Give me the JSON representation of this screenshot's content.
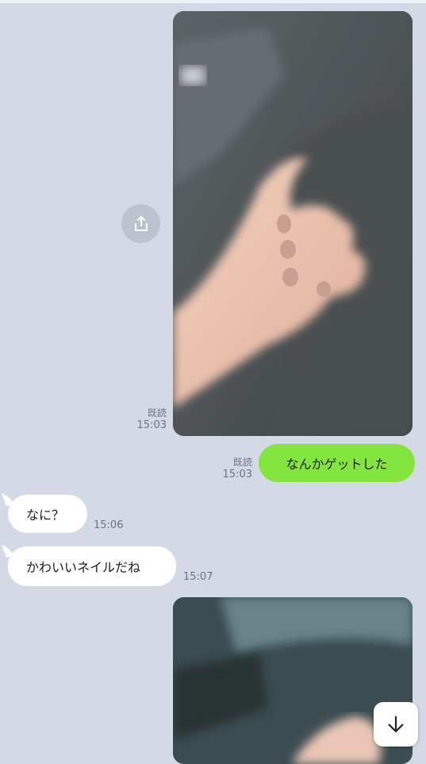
{
  "messages": {
    "photo1": {
      "read_label": "既読",
      "time": "15:03"
    },
    "sent_text": {
      "text": "なんかゲットした",
      "read_label": "既読",
      "time": "15:03"
    },
    "recv1": {
      "text": "なに？",
      "time": "15:06"
    },
    "recv2": {
      "text": "かわいいネイルだね",
      "time": "15:07"
    }
  },
  "icons": {
    "share": "share-icon",
    "scroll_down": "arrow-down-icon"
  },
  "colors": {
    "background": "#d3dae6",
    "sent_bubble": "#84e53f",
    "received_bubble": "#ffffff"
  }
}
